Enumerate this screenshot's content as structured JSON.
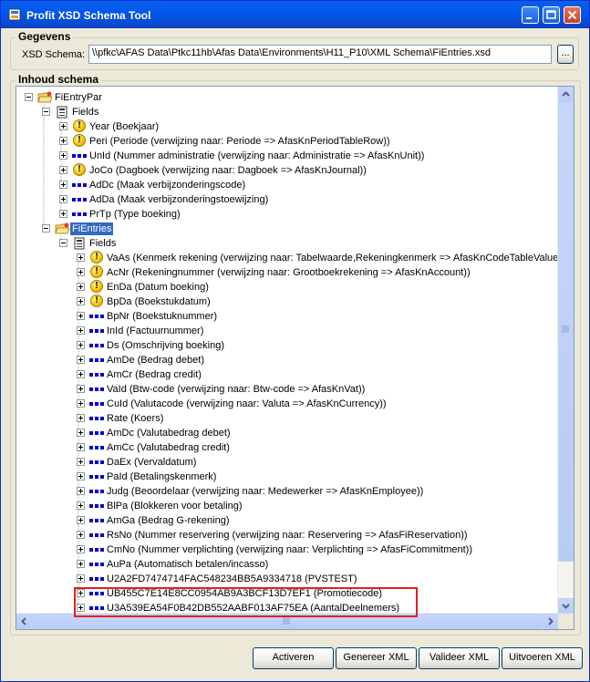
{
  "window": {
    "title": "Profit XSD Schema Tool"
  },
  "gegevens": {
    "group_label": "Gegevens",
    "xsd_label": "XSD Schema:",
    "xsd_value": "\\\\pfkc\\AFAS Data\\Ptkc11hb\\Afas Data\\Environments\\H11_P10\\XML Schema\\FiEntries.xsd",
    "browse_label": "..."
  },
  "inhoud": {
    "group_label": "Inhoud schema",
    "tree": [
      {
        "label": "FiEntryPar",
        "icon": "folder-icon",
        "level": 0,
        "expander": "minus"
      },
      {
        "label": "Fields",
        "icon": "fields-icon",
        "level": 1,
        "expander": "minus"
      },
      {
        "label": "Year (Boekjaar)",
        "icon": "warning-icon",
        "level": 2,
        "expander": "plus"
      },
      {
        "label": "Peri (Periode (verwijzing naar: Periode => AfasKnPeriodTableRow))",
        "icon": "warning-icon",
        "level": 2,
        "expander": "plus"
      },
      {
        "label": "UnId (Nummer administratie (verwijzing naar: Administratie => AfasKnUnit))",
        "icon": "field-icon",
        "level": 2,
        "expander": "plus"
      },
      {
        "label": "JoCo (Dagboek (verwijzing naar: Dagboek => AfasKnJournal))",
        "icon": "warning-icon",
        "level": 2,
        "expander": "plus"
      },
      {
        "label": "AdDc (Maak verbijzonderingscode)",
        "icon": "field-icon",
        "level": 2,
        "expander": "plus"
      },
      {
        "label": "AdDa (Maak verbijzonderingstoewijzing)",
        "icon": "field-icon",
        "level": 2,
        "expander": "plus"
      },
      {
        "label": "PrTp (Type boeking)",
        "icon": "field-icon",
        "level": 2,
        "expander": "plus"
      },
      {
        "label": "FiEntries",
        "icon": "folder-icon",
        "level": 1,
        "expander": "minus",
        "selected": true
      },
      {
        "label": "Fields",
        "icon": "fields-icon",
        "level": 2,
        "expander": "minus"
      },
      {
        "label": "VaAs (Kenmerk rekening (verwijzing naar: Tabelwaarde,Rekeningkenmerk => AfasKnCodeTableValue))",
        "icon": "warning-icon",
        "level": 3,
        "expander": "plus"
      },
      {
        "label": "AcNr (Rekeningnummer (verwijzing naar: Grootboekrekening => AfasKnAccount))",
        "icon": "warning-icon",
        "level": 3,
        "expander": "plus"
      },
      {
        "label": "EnDa (Datum boeking)",
        "icon": "warning-icon",
        "level": 3,
        "expander": "plus"
      },
      {
        "label": "BpDa (Boekstukdatum)",
        "icon": "warning-icon",
        "level": 3,
        "expander": "plus"
      },
      {
        "label": "BpNr (Boekstuknummer)",
        "icon": "field-icon",
        "level": 3,
        "expander": "plus"
      },
      {
        "label": "InId (Factuurnummer)",
        "icon": "field-icon",
        "level": 3,
        "expander": "plus"
      },
      {
        "label": "Ds (Omschrijving boeking)",
        "icon": "field-icon",
        "level": 3,
        "expander": "plus"
      },
      {
        "label": "AmDe (Bedrag debet)",
        "icon": "field-icon",
        "level": 3,
        "expander": "plus"
      },
      {
        "label": "AmCr (Bedrag credit)",
        "icon": "field-icon",
        "level": 3,
        "expander": "plus"
      },
      {
        "label": "VaId (Btw-code (verwijzing naar: Btw-code => AfasKnVat))",
        "icon": "field-icon",
        "level": 3,
        "expander": "plus"
      },
      {
        "label": "CuId (Valutacode (verwijzing naar: Valuta => AfasKnCurrency))",
        "icon": "field-icon",
        "level": 3,
        "expander": "plus"
      },
      {
        "label": "Rate (Koers)",
        "icon": "field-icon",
        "level": 3,
        "expander": "plus"
      },
      {
        "label": "AmDc (Valutabedrag debet)",
        "icon": "field-icon",
        "level": 3,
        "expander": "plus"
      },
      {
        "label": "AmCc (Valutabedrag credit)",
        "icon": "field-icon",
        "level": 3,
        "expander": "plus"
      },
      {
        "label": "DaEx (Vervaldatum)",
        "icon": "field-icon",
        "level": 3,
        "expander": "plus"
      },
      {
        "label": "PaId (Betalingskenmerk)",
        "icon": "field-icon",
        "level": 3,
        "expander": "plus"
      },
      {
        "label": "Judg (Beoordelaar (verwijzing naar: Medewerker => AfasKnEmployee))",
        "icon": "field-icon",
        "level": 3,
        "expander": "plus"
      },
      {
        "label": "BlPa (Blokkeren voor betaling)",
        "icon": "field-icon",
        "level": 3,
        "expander": "plus"
      },
      {
        "label": "AmGa (Bedrag G-rekening)",
        "icon": "field-icon",
        "level": 3,
        "expander": "plus"
      },
      {
        "label": "RsNo (Nummer reservering (verwijzing naar: Reservering => AfasFiReservation))",
        "icon": "field-icon",
        "level": 3,
        "expander": "plus"
      },
      {
        "label": "CmNo (Nummer verplichting (verwijzing naar: Verplichting => AfasFiCommitment))",
        "icon": "field-icon",
        "level": 3,
        "expander": "plus"
      },
      {
        "label": "AuPa (Automatisch betalen/incasso)",
        "icon": "field-icon",
        "level": 3,
        "expander": "plus"
      },
      {
        "label": "U2A2FD7474714FAC548234BB5A9334718 (PVSTEST)",
        "icon": "field-icon",
        "level": 3,
        "expander": "plus"
      },
      {
        "label": "UB455C7E14E8CC0954AB9A3BCF13D7EF1 (Promotiecode)",
        "icon": "field-icon",
        "level": 3,
        "expander": "plus"
      },
      {
        "label": "U3A539EA54F0B42DB552AABF013AF75EA (AantalDeelnemers)",
        "icon": "field-icon",
        "level": 3,
        "expander": "plus"
      }
    ]
  },
  "buttons": {
    "activeren": "Activeren",
    "genereer": "Genereer XML",
    "valideer": "Valideer XML",
    "uitvoeren": "Uitvoeren XML"
  },
  "colors": {
    "selection": "#316ac5",
    "highlight_box": "#e41e1e",
    "field_icon": "#0000d0"
  }
}
